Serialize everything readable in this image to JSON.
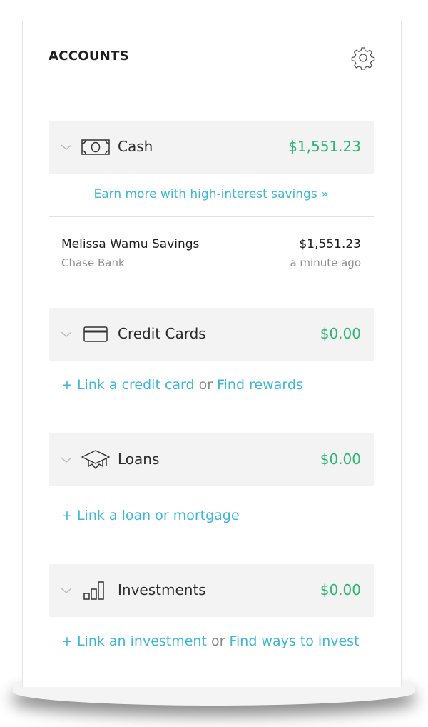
{
  "header": {
    "title": "ACCOUNTS",
    "settings_icon": "gear-icon"
  },
  "colors": {
    "positive": "#2bb673",
    "link": "#3cb7d6",
    "section_bg": "#f3f3f3"
  },
  "cash": {
    "label": "Cash",
    "total": "$1,551.23",
    "promo": "Earn more with high-interest savings »",
    "account": {
      "name": "Melissa Wamu Savings",
      "institution": "Chase Bank",
      "balance": "$1,551.23",
      "updated": "a minute ago"
    }
  },
  "credit_cards": {
    "label": "Credit Cards",
    "total": "$0.00",
    "link_primary": "+ Link a credit card",
    "separator": "or",
    "link_secondary": "Find rewards"
  },
  "loans": {
    "label": "Loans",
    "total": "$0.00",
    "link_primary": "+ Link a loan or mortgage"
  },
  "investments": {
    "label": "Investments",
    "total": "$0.00",
    "link_primary": "+ Link an investment",
    "separator": "or",
    "link_secondary": "Find ways to invest"
  }
}
